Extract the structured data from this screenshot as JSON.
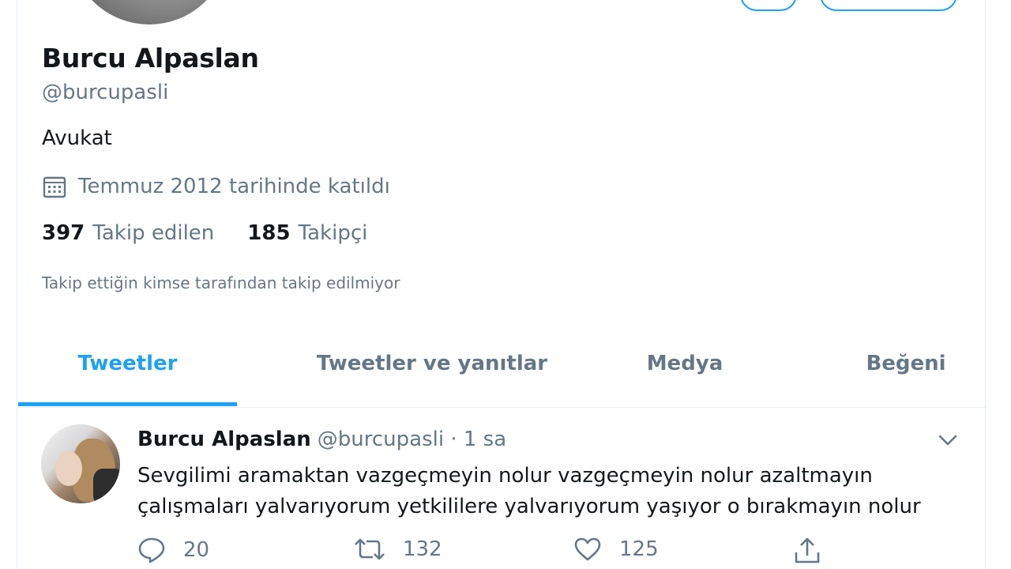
{
  "profile": {
    "name": "Burcu Alpaslan",
    "handle": "@burcupasli",
    "bio": "Avukat",
    "joined": "Temmuz 2012 tarihinde katıldı",
    "following_count": "397",
    "following_label": "Takip edilen",
    "followers_count": "185",
    "followers_label": "Takipçi",
    "followers_you_know": "Takip ettiğin kimse tarafından takip edilmiyor"
  },
  "tabs": [
    {
      "label": "Tweetler",
      "active": true
    },
    {
      "label": "Tweetler ve yanıtlar",
      "active": false
    },
    {
      "label": "Medya",
      "active": false
    },
    {
      "label": "Beğeni",
      "active": false
    }
  ],
  "tweet": {
    "name": "Burcu Alpaslan",
    "meta": "@burcupasli · 1 sa",
    "text": "Sevgilimi aramaktan vazgeçmeyin nolur vazgeçmeyin nolur azaltmayın çalışmaları yalvarıyorum yetkililere yalvarıyorum yaşıyor o bırakmayın nolur",
    "replies": "20",
    "retweets": "132",
    "likes": "125"
  },
  "icons": {
    "calendar": "calendar-icon",
    "reply": "reply-icon",
    "retweet": "retweet-icon",
    "like": "heart-icon",
    "share": "share-icon",
    "more": "chevron-down-icon"
  },
  "colors": {
    "accent": "#1da1f2",
    "secondary_text": "#657786",
    "primary_text": "#14171a",
    "border": "#e6ecf0"
  }
}
